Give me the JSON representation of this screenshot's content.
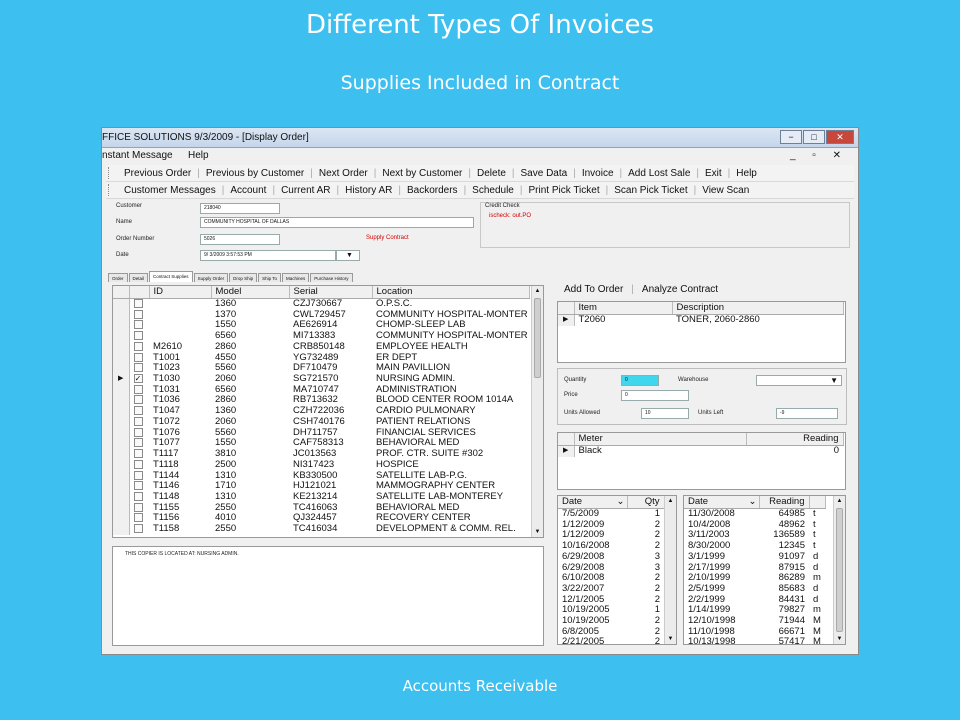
{
  "slide": {
    "title": "Different Types Of Invoices",
    "subtitle": "Supplies Included in Contract",
    "footer": "Accounts Receivable"
  },
  "window": {
    "title": "FFICE SOLUTIONS 9/3/2009 - [Display Order]",
    "controls": {
      "minimize": "−",
      "maximize": "□",
      "close": "✕"
    }
  },
  "menubar": {
    "items": [
      "nstant Message",
      "Help"
    ],
    "mdi_controls": "_ ▫ ✕"
  },
  "toolbar1": [
    "Previous Order",
    "Previous by Customer",
    "Next Order",
    "Next by Customer",
    "Delete",
    "Save Data",
    "Invoice",
    "Add Lost Sale",
    "Exit",
    "Help"
  ],
  "toolbar2": [
    "Customer Messages",
    "Account",
    "Current AR",
    "History AR",
    "Backorders",
    "Schedule",
    "Print Pick Ticket",
    "Scan Pick Ticket",
    "View Scan"
  ],
  "form": {
    "customer_label": "Customer",
    "customer_value": "218040",
    "name_label": "Name",
    "name_value": "COMMUNITY HOSPITAL OF DALLAS",
    "order_label": "Order Number",
    "order_value": "5026",
    "supply_note": "Supply Contract",
    "date_label": "Date",
    "date_value": "9/ 3/2009  3:57:53 PM",
    "credit_label": "Credit Check",
    "credit_note": "ischeck: out.PO"
  },
  "tabs": [
    "Order",
    "Detail",
    "Contract Supplies",
    "Supply Order",
    "Drop Ship",
    "Ship To",
    "Machines",
    "Purchase History"
  ],
  "active_tab": "Contract Supplies",
  "machines": {
    "headers": [
      "ID",
      "Model",
      "Serial",
      "Location"
    ],
    "rows": [
      {
        "check": false,
        "id": "",
        "model": "1360",
        "serial": "CZJ730667",
        "location": "O.P.S.C."
      },
      {
        "check": false,
        "id": "",
        "model": "1370",
        "serial": "CWL729457",
        "location": "COMMUNITY HOSPITAL-MONTER"
      },
      {
        "check": false,
        "id": "",
        "model": "1550",
        "serial": "AE626914",
        "location": "CHOMP-SLEEP LAB"
      },
      {
        "check": false,
        "id": "",
        "model": "6560",
        "serial": "MI713383",
        "location": "COMMUNITY HOSPITAL-MONTER"
      },
      {
        "check": false,
        "id": "M2610",
        "model": "2860",
        "serial": "CRB850148",
        "location": "EMPLOYEE HEALTH"
      },
      {
        "check": false,
        "id": "T1001",
        "model": "4550",
        "serial": "YG732489",
        "location": "ER DEPT"
      },
      {
        "check": false,
        "id": "T1023",
        "model": "5560",
        "serial": "DF710479",
        "location": "MAIN PAVILLION"
      },
      {
        "check": true,
        "id": "T1030",
        "model": "2060",
        "serial": "SG721570",
        "location": "NURSING ADMIN."
      },
      {
        "check": false,
        "id": "T1031",
        "model": "6560",
        "serial": "MA710747",
        "location": "ADMINISTRATION"
      },
      {
        "check": false,
        "id": "T1036",
        "model": "2860",
        "serial": "RB713632",
        "location": "BLOOD CENTER  ROOM 1014A"
      },
      {
        "check": false,
        "id": "T1047",
        "model": "1360",
        "serial": "CZH722036",
        "location": "CARDIO PULMONARY"
      },
      {
        "check": false,
        "id": "T1072",
        "model": "2060",
        "serial": "CSH740176",
        "location": "PATIENT RELATIONS"
      },
      {
        "check": false,
        "id": "T1076",
        "model": "5560",
        "serial": "DH711757",
        "location": "FINANCIAL SERVICES"
      },
      {
        "check": false,
        "id": "T1077",
        "model": "1550",
        "serial": "CAF758313",
        "location": "BEHAVIORAL MED"
      },
      {
        "check": false,
        "id": "T1117",
        "model": "3810",
        "serial": "JC013563",
        "location": "PROF. CTR. SUITE #302"
      },
      {
        "check": false,
        "id": "T1118",
        "model": "2500",
        "serial": "NI317423",
        "location": "HOSPICE"
      },
      {
        "check": false,
        "id": "T1144",
        "model": "1310",
        "serial": "KB330500",
        "location": "SATELLITE LAB-P.G."
      },
      {
        "check": false,
        "id": "T1146",
        "model": "1710",
        "serial": "HJ121021",
        "location": "MAMMOGRAPHY CENTER"
      },
      {
        "check": false,
        "id": "T1148",
        "model": "1310",
        "serial": "KE213214",
        "location": "SATELLITE LAB-MONTEREY"
      },
      {
        "check": false,
        "id": "T1155",
        "model": "2550",
        "serial": "TC416063",
        "location": "BEHAVIORAL MED"
      },
      {
        "check": false,
        "id": "T1156",
        "model": "4010",
        "serial": "QJ324457",
        "location": "RECOVERY CENTER"
      },
      {
        "check": false,
        "id": "T1158",
        "model": "2550",
        "serial": "TC416034",
        "location": "DEVELOPMENT & COMM. REL."
      }
    ],
    "current_row_marker": "▶"
  },
  "notes": "THIS COPIER IS LOCATED AT:  NURSING ADMIN.",
  "contract_toolbar": [
    "Add To Order",
    "Analyze Contract"
  ],
  "items_grid": {
    "headers": [
      "Item",
      "Description"
    ],
    "rows": [
      {
        "item": "T2060",
        "description": "TONER, 2060-2860"
      }
    ]
  },
  "qty_panel": {
    "quantity_label": "Quantity",
    "quantity_value": "0",
    "warehouse_label": "Warehouse",
    "price_label": "Price",
    "price_value": "0",
    "units_allowed_label": "Units Allowed",
    "units_allowed_value": "10",
    "units_left_label": "Units Left",
    "units_left_value": "-9"
  },
  "meter_grid": {
    "headers": [
      "Meter",
      "Reading"
    ],
    "rows": [
      {
        "meter": "Black",
        "reading": "0"
      }
    ]
  },
  "date_qty": {
    "headers": [
      "Date",
      "Qty"
    ],
    "rows": [
      [
        "7/5/2009",
        "1"
      ],
      [
        "1/12/2009",
        "2"
      ],
      [
        "1/12/2009",
        "2"
      ],
      [
        "10/16/2008",
        "2"
      ],
      [
        "6/29/2008",
        "3"
      ],
      [
        "6/29/2008",
        "3"
      ],
      [
        "6/10/2008",
        "2"
      ],
      [
        "3/22/2007",
        "2"
      ],
      [
        "12/1/2005",
        "2"
      ],
      [
        "10/19/2005",
        "1"
      ],
      [
        "10/19/2005",
        "2"
      ],
      [
        "6/8/2005",
        "2"
      ],
      [
        "2/21/2005",
        "2"
      ]
    ]
  },
  "date_reading": {
    "headers": [
      "Date",
      "Reading"
    ],
    "rows": [
      [
        "11/30/2008",
        "64985",
        "t"
      ],
      [
        "10/4/2008",
        "48962",
        "t"
      ],
      [
        "3/11/2003",
        "136589",
        "t"
      ],
      [
        "8/30/2000",
        "12345",
        "t"
      ],
      [
        "3/1/1999",
        "91097",
        "d"
      ],
      [
        "2/17/1999",
        "87915",
        "d"
      ],
      [
        "2/10/1999",
        "86289",
        "m"
      ],
      [
        "2/5/1999",
        "85683",
        "d"
      ],
      [
        "2/2/1999",
        "84431",
        "d"
      ],
      [
        "1/14/1999",
        "79827",
        "m"
      ],
      [
        "12/10/1998",
        "71944",
        "M"
      ],
      [
        "11/10/1998",
        "66671",
        "M"
      ],
      [
        "10/13/1998",
        "57417",
        "M"
      ]
    ]
  },
  "glyphs": {
    "sort": "⌄",
    "up": "▲",
    "down": "▼",
    "check": "✓",
    "dropdown": "▼"
  }
}
